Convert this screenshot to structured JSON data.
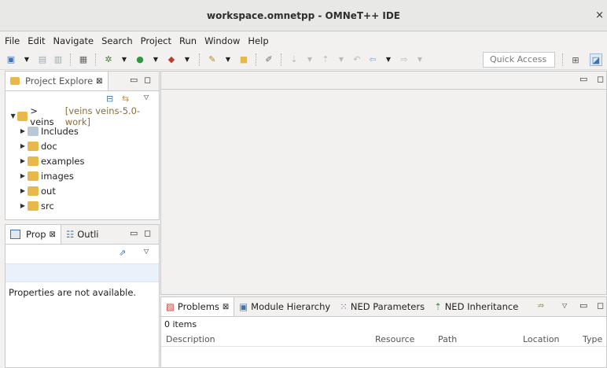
{
  "window": {
    "title": "workspace.omnetpp - OMNeT++ IDE",
    "close": "×"
  },
  "menu": [
    "File",
    "Edit",
    "Navigate",
    "Search",
    "Project",
    "Run",
    "Window",
    "Help"
  ],
  "toolbar": {
    "quick_access": "Quick Access"
  },
  "project_explorer": {
    "tab_label": "Project Explore",
    "root": {
      "name": "> veins",
      "detail": "[veins veins-5.0-work]"
    },
    "children": [
      "Includes",
      "doc",
      "examples",
      "images",
      "out",
      "src"
    ]
  },
  "properties": {
    "tab_label": "Prop",
    "outline_label": "Outli",
    "message": "Properties are not available."
  },
  "bottom": {
    "tabs": [
      "Problems",
      "Module Hierarchy",
      "NED Parameters",
      "NED Inheritance"
    ],
    "count": "0 items",
    "columns": [
      "Description",
      "Resource",
      "Path",
      "Location",
      "Type"
    ]
  },
  "colors": {
    "accent": "#3b73b9",
    "folder": "#e8b84a",
    "run": "#2e9a3a",
    "tab_active_bg": "#ffffff"
  }
}
